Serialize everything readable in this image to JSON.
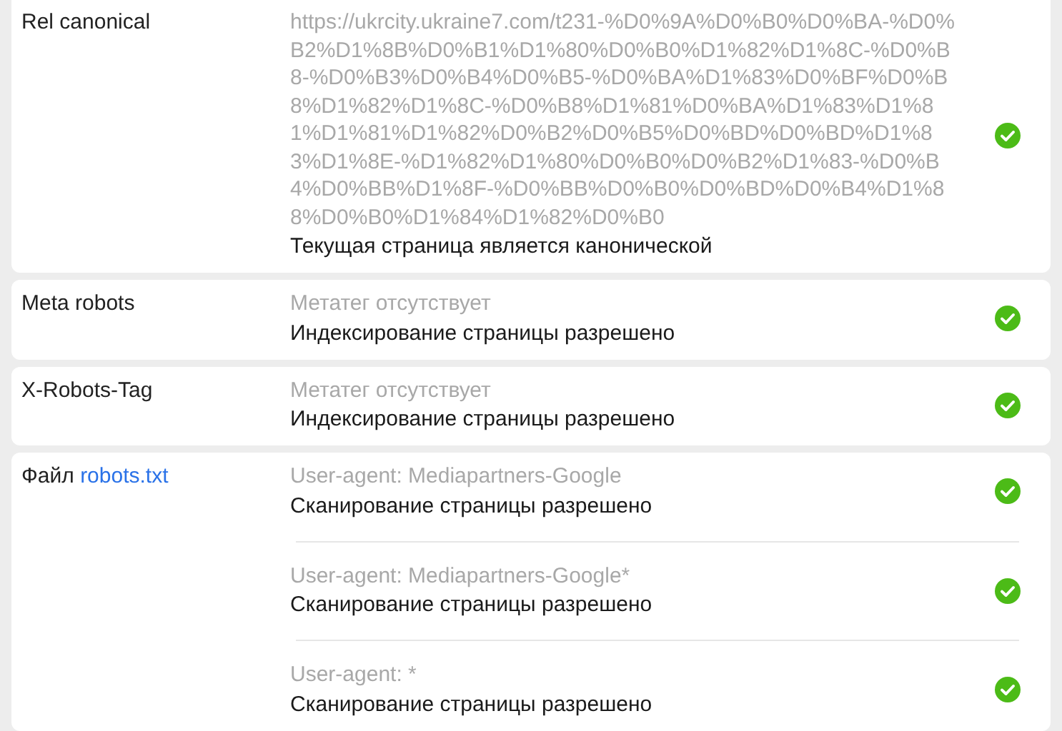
{
  "rows": [
    {
      "label": "Rel canonical",
      "entries": [
        {
          "detail": "https://ukrcity.ukraine7.com/t231-%D0%9A%D0%B0%D0%BA-%D0%B2%D1%8B%D0%B1%D1%80%D0%B0%D1%82%D1%8C-%D0%B8-%D0%B3%D0%B4%D0%B5-%D0%BA%D1%83%D0%BF%D0%B8%D1%82%D1%8C-%D0%B8%D1%81%D0%BA%D1%83%D1%81%D1%81%D1%82%D0%B2%D0%B5%D0%BD%D0%BD%D1%83%D1%8E-%D1%82%D1%80%D0%B0%D0%B2%D1%83-%D0%B4%D0%BB%D1%8F-%D0%BB%D0%B0%D0%BD%D0%B4%D1%88%D0%B0%D1%84%D1%82%D0%B0",
          "result": "Текущая страница является канонической",
          "passed": true
        }
      ]
    },
    {
      "label": "Meta robots",
      "entries": [
        {
          "detail": "Метатег отсутствует",
          "result": "Индексирование страницы разрешено",
          "passed": true
        }
      ]
    },
    {
      "label": "X-Robots-Tag",
      "entries": [
        {
          "detail": "Метатег отсутствует",
          "result": "Индексирование страницы разрешено",
          "passed": true
        }
      ]
    },
    {
      "label": "Файл",
      "link": "robots.txt",
      "entries": [
        {
          "detail": "User-agent: Mediapartners-Google",
          "result": "Сканирование страницы разрешено",
          "passed": true
        },
        {
          "detail": "User-agent: Mediapartners-Google*",
          "result": "Сканирование страницы разрешено",
          "passed": true
        },
        {
          "detail": "User-agent: *",
          "result": "Сканирование страницы разрешено",
          "passed": true
        }
      ]
    }
  ]
}
